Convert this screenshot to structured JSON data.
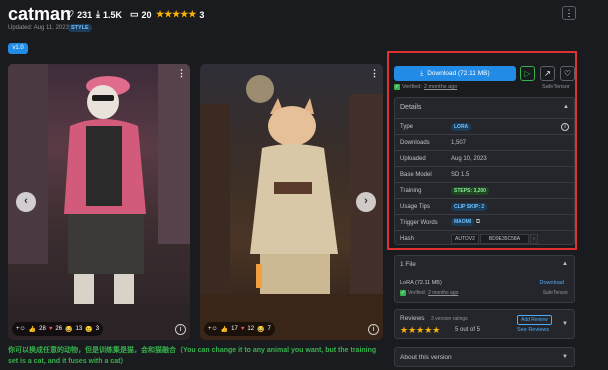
{
  "header": {
    "title": "catman",
    "likes": "231",
    "downloads": "1.5K",
    "comments": "20",
    "stars": "★★★★★",
    "rating_count": "3",
    "updated": "Updated: Aug 11, 2023",
    "style_badge": "STYLE",
    "menu_glyph": "⋮"
  },
  "version": {
    "label": "v1.0"
  },
  "gallery": {
    "prev": "‹",
    "next": "›",
    "img1_reactions": [
      "28",
      "26",
      "13",
      "3"
    ],
    "img2_reactions": [
      "17",
      "12",
      "7"
    ],
    "dots": "⋮",
    "info": "i"
  },
  "sidebar": {
    "download_label": "Download (72.11 MB)",
    "verified_text": "Verified:",
    "verified_when": "2 months ago",
    "safetensor": "SafeTensor",
    "details_title": "Details",
    "rows": [
      {
        "label": "Type",
        "value": "LORA"
      },
      {
        "label": "Downloads",
        "value": "1,507"
      },
      {
        "label": "Uploaded",
        "value": "Aug 10, 2023"
      },
      {
        "label": "Base Model",
        "value": "SD 1.5"
      },
      {
        "label": "Training",
        "value": "STEPS: 3,200"
      },
      {
        "label": "Usage Tips",
        "value": "CLIP SKIP: 2"
      },
      {
        "label": "Trigger Words",
        "value": "MAOMI"
      },
      {
        "label": "Hash",
        "value": "AUTOV2",
        "value2": "BD9E35C58A"
      }
    ],
    "files_title": "1 File",
    "file_name": "LoRA (72.11 MB)",
    "file_download": "Download",
    "file_verified": "Verified:",
    "file_when": "2 months ago",
    "file_safetensor": "SafeTensor",
    "reviews_title": "Reviews",
    "reviews_count": "3 version ratings",
    "reviews_stars": "★★★★★",
    "reviews_score": "5 out of 5",
    "add_review": "Add Review",
    "see_reviews": "See Reviews",
    "about_title": "About this version"
  },
  "description": "你可以换成任意的动物，但是训练集是猫，会和猫融合（You can change it to any animal you want, but the training set is a cat, and it fuses with a cat）",
  "colors": {
    "accent": "#228be6",
    "highlight": "#e03131",
    "desc": "#37b24d"
  }
}
